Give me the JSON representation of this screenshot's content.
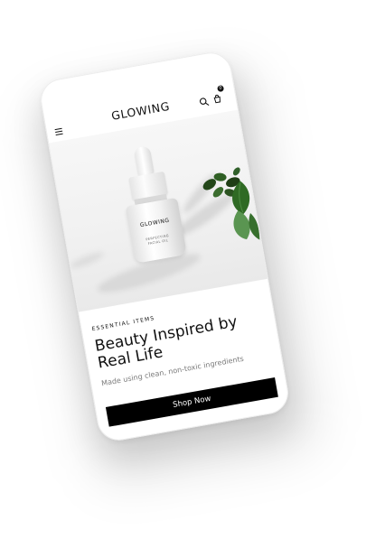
{
  "header": {
    "logo": "GLOWING",
    "cart_count": "0",
    "menu_icon": "menu-icon",
    "search_icon": "search-icon",
    "cart_icon": "cart-icon"
  },
  "hero": {
    "product_brand": "GLOWING",
    "product_subtitle": "PERFECTING\nFACIAL OIL"
  },
  "content": {
    "eyebrow": "ESSENTIAL ITEMS",
    "title": "Beauty Inspired by Real Life",
    "description": "Made using clean, non-toxic ingredients",
    "cta_label": "Shop Now"
  },
  "colors": {
    "text": "#111111",
    "muted": "#7c7c7c",
    "button": "#000000",
    "leaf": "#2f5f24",
    "background": "#ffffff"
  }
}
